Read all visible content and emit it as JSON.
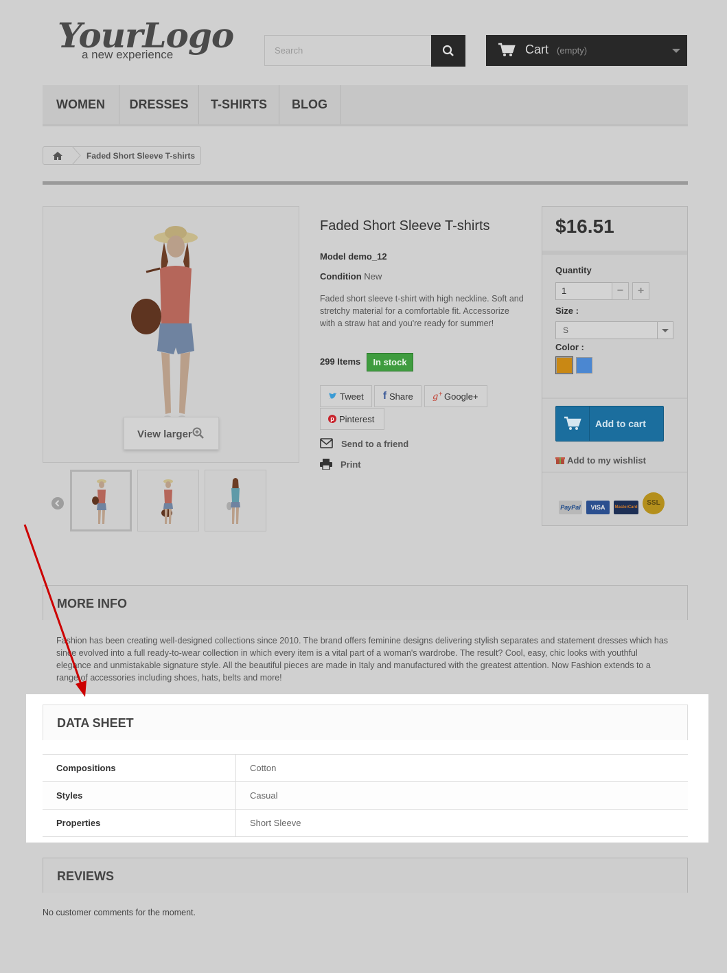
{
  "header": {
    "logo_main": "YourLogo",
    "logo_sub": "a new experience",
    "search_placeholder": "Search",
    "cart_label": "Cart",
    "cart_state": "(empty)"
  },
  "nav": {
    "items": [
      "WOMEN",
      "DRESSES",
      "T-SHIRTS",
      "BLOG"
    ]
  },
  "breadcrumb": {
    "current": "Faded Short Sleeve T-shirts"
  },
  "gallery": {
    "view_larger": "View larger"
  },
  "product": {
    "title": "Faded Short Sleeve T-shirts",
    "model_label": "Model",
    "model_value": "demo_12",
    "condition_label": "Condition",
    "condition_value": "New",
    "description": "Faded short sleeve t-shirt with high neckline. Soft and stretchy material for a comfortable fit. Accessorize with a straw hat and you're ready for summer!",
    "quantity_in_stock": "299 Items",
    "stock_status": "In stock",
    "share_buttons": [
      "Tweet",
      "Share",
      "Google+",
      "Pinterest"
    ],
    "send_to_friend": "Send to a friend",
    "print": "Print"
  },
  "buy_box": {
    "price": "$16.51",
    "quantity_label": "Quantity",
    "quantity_value": "1",
    "size_label": "Size :",
    "size_value": "S",
    "color_label": "Color :",
    "colors": [
      "#c98814",
      "#4b87d1"
    ],
    "add_to_cart": "Add to cart",
    "wishlist": "Add to my wishlist",
    "payment": [
      "PayPal",
      "VISA",
      "MasterCard",
      "SSL"
    ]
  },
  "more_info": {
    "heading": "MORE INFO",
    "text": "Fashion has been creating well-designed collections since 2010. The brand offers feminine designs delivering stylish separates and statement dresses which has since evolved into a full ready-to-wear collection in which every item is a vital part of a woman's wardrobe. The result? Cool, easy, chic looks with youthful elegance and unmistakable signature style. All the beautiful pieces are made in Italy and manufactured with the greatest attention. Now Fashion extends to a range of accessories including shoes, hats, belts and more!"
  },
  "data_sheet": {
    "heading": "DATA SHEET",
    "rows": [
      {
        "key": "Compositions",
        "value": "Cotton"
      },
      {
        "key": "Styles",
        "value": "Casual"
      },
      {
        "key": "Properties",
        "value": "Short Sleeve"
      }
    ]
  },
  "reviews": {
    "heading": "REVIEWS",
    "empty_text": "No customer comments for the moment."
  },
  "colors": {
    "annotation_arrow": "#cc0000",
    "stock_green": "#3f9c3f",
    "cart_blue": "#1b6e9e"
  }
}
